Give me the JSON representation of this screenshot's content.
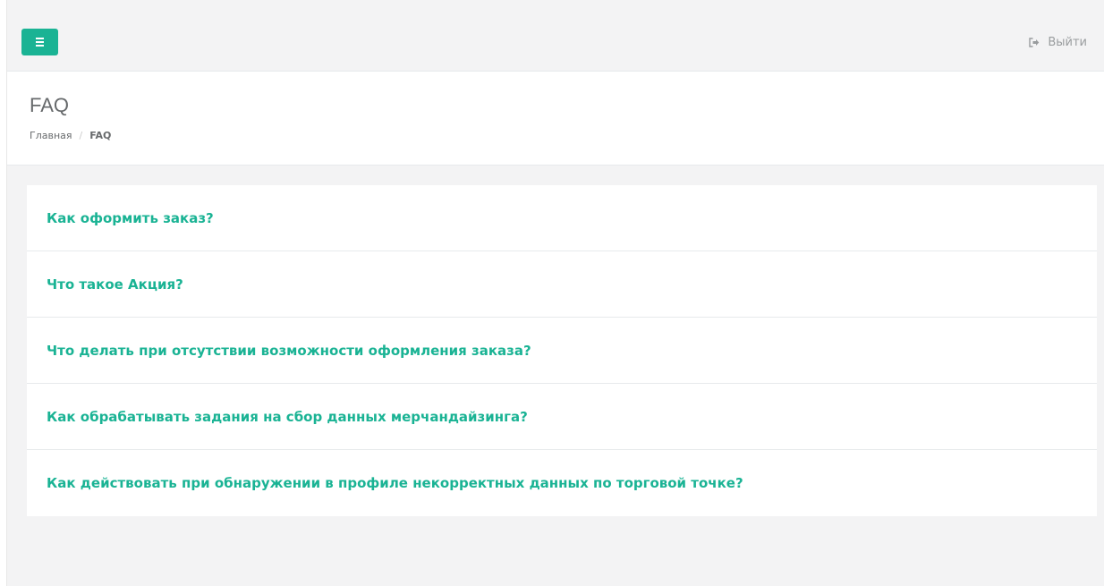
{
  "topbar": {
    "menu_icon": "hamburger-icon",
    "logout_icon": "sign-out-icon",
    "logout_label": "Выйти"
  },
  "page": {
    "title": "FAQ",
    "breadcrumb": {
      "home": "Главная",
      "separator": "/",
      "current": "FAQ"
    }
  },
  "faq": {
    "items": [
      {
        "question": "Как оформить заказ?"
      },
      {
        "question": "Что такое Акция?"
      },
      {
        "question": "Что делать при отсутствии возможности оформления заказа?"
      },
      {
        "question": "Как обрабатывать задания на сбор данных мерчандайзинга?"
      },
      {
        "question": "Как действовать при обнаружении в профиле некорректных данных по торговой точке?"
      }
    ]
  },
  "colors": {
    "accent": "#1ab394",
    "text": "#676a6c",
    "muted": "#999c9e",
    "background": "#f3f3f4"
  }
}
